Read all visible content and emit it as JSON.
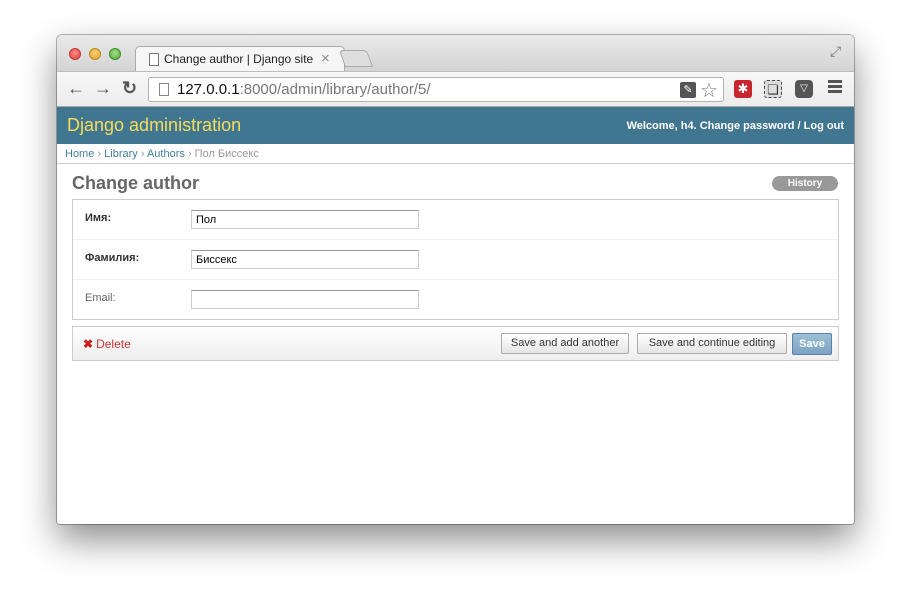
{
  "browser": {
    "tab_title": "Change author | Django site",
    "tab_close": "×",
    "url_host": "127.0.0.1",
    "url_rest": ":8000/admin/library/author/5/",
    "back_icon": "arrow-left",
    "forward_icon": "arrow-right",
    "reload_icon": "reload",
    "colors": {
      "titlebar": "#d4d4d4",
      "close": "#e0443e",
      "min": "#dea123",
      "max": "#53a83a"
    }
  },
  "header": {
    "branding": "Django administration",
    "welcome": "Welcome, h4.",
    "change_password": "Change password",
    "separator": "/",
    "logout": "Log out",
    "colors": {
      "header_bg": "#417690",
      "branding": "#f5dd5d"
    }
  },
  "breadcrumbs": {
    "home": "Home",
    "library": "Library",
    "authors": "Authors",
    "current": "Пол Биссекс",
    "sep": "›"
  },
  "page": {
    "title": "Change author",
    "history_button": "History"
  },
  "form": {
    "fields": [
      {
        "label": "Имя:",
        "value": "Пол",
        "required": true
      },
      {
        "label": "Фамилия:",
        "value": "Биссекс",
        "required": true
      },
      {
        "label": "Email:",
        "value": "",
        "required": false
      }
    ]
  },
  "submit_row": {
    "delete": "Delete",
    "save_add_another": "Save and add another",
    "save_continue": "Save and continue editing",
    "save": "Save"
  }
}
